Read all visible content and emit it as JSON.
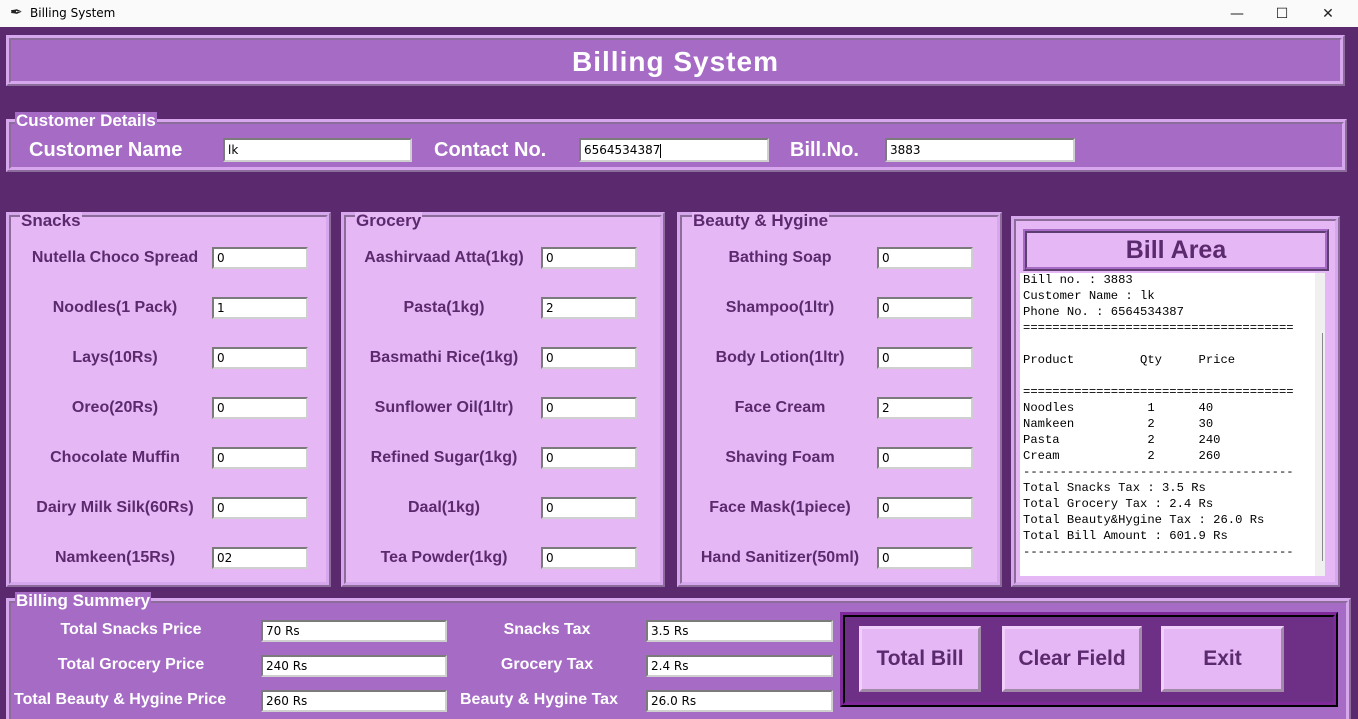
{
  "window": {
    "title": "Billing System",
    "minimize_glyph": "—",
    "maximize_glyph": "☐",
    "close_glyph": "✕",
    "app_icon": "feather-icon"
  },
  "header": {
    "title": "Billing System"
  },
  "customer": {
    "legend": "Customer Details",
    "name_label": "Customer Name",
    "name_value": "lk",
    "contact_label": "Contact No.",
    "contact_value": "6564534387",
    "bill_label": "Bill.No.",
    "bill_value": "3883"
  },
  "snacks": {
    "legend": "Snacks",
    "items": [
      {
        "label": "Nutella Choco Spread",
        "qty": "0"
      },
      {
        "label": "Noodles(1 Pack)",
        "qty": "1"
      },
      {
        "label": "Lays(10Rs)",
        "qty": "0"
      },
      {
        "label": "Oreo(20Rs)",
        "qty": "0"
      },
      {
        "label": "Chocolate Muffin",
        "qty": "0"
      },
      {
        "label": "Dairy Milk Silk(60Rs)",
        "qty": "0"
      },
      {
        "label": "Namkeen(15Rs)",
        "qty": "02"
      }
    ]
  },
  "grocery": {
    "legend": "Grocery",
    "items": [
      {
        "label": "Aashirvaad Atta(1kg)",
        "qty": "0"
      },
      {
        "label": "Pasta(1kg)",
        "qty": "2"
      },
      {
        "label": "Basmathi Rice(1kg)",
        "qty": "0"
      },
      {
        "label": "Sunflower Oil(1ltr)",
        "qty": "0"
      },
      {
        "label": "Refined Sugar(1kg)",
        "qty": "0"
      },
      {
        "label": "Daal(1kg)",
        "qty": "0"
      },
      {
        "label": "Tea Powder(1kg)",
        "qty": "0"
      }
    ]
  },
  "beauty": {
    "legend": "Beauty & Hygine",
    "items": [
      {
        "label": "Bathing Soap",
        "qty": "0"
      },
      {
        "label": "Shampoo(1ltr)",
        "qty": "0"
      },
      {
        "label": "Body Lotion(1ltr)",
        "qty": "0"
      },
      {
        "label": "Face Cream",
        "qty": "2"
      },
      {
        "label": "Shaving Foam",
        "qty": "0"
      },
      {
        "label": "Face Mask(1piece)",
        "qty": "0"
      },
      {
        "label": "Hand Sanitizer(50ml)",
        "qty": "0"
      }
    ]
  },
  "bill_area": {
    "title": "Bill Area",
    "text": "Bill no. : 3883\nCustomer Name : lk\nPhone No. : 6564534387\n=====================================\n\nProduct         Qty     Price\n\n=====================================\nNoodles          1      40\nNamkeen          2      30\nPasta            2      240\nCream            2      260\n-------------------------------------\nTotal Snacks Tax : 3.5 Rs\nTotal Grocery Tax : 2.4 Rs\nTotal Beauty&Hygine Tax : 26.0 Rs\nTotal Bill Amount : 601.9 Rs\n-------------------------------------"
  },
  "summary": {
    "legend": "Billing Summery",
    "snacks_price_label": "Total Snacks Price",
    "snacks_price_value": "70 Rs",
    "grocery_price_label": "Total Grocery Price",
    "grocery_price_value": "240 Rs",
    "beauty_price_label": "Total Beauty & Hygine Price",
    "beauty_price_value": "260 Rs",
    "snacks_tax_label": "Snacks Tax",
    "snacks_tax_value": "3.5 Rs",
    "grocery_tax_label": "Grocery Tax",
    "grocery_tax_value": "2.4 Rs",
    "beauty_tax_label": "Beauty & Hygine Tax",
    "beauty_tax_value": "26.0 Rs"
  },
  "buttons": {
    "total": "Total Bill",
    "clear": "Clear Field",
    "exit": "Exit"
  },
  "colors": {
    "background": "#5b2a6e",
    "frame": "#a56bc5",
    "panel": "#e6b7f5",
    "text_dark": "#5b2a6e"
  }
}
